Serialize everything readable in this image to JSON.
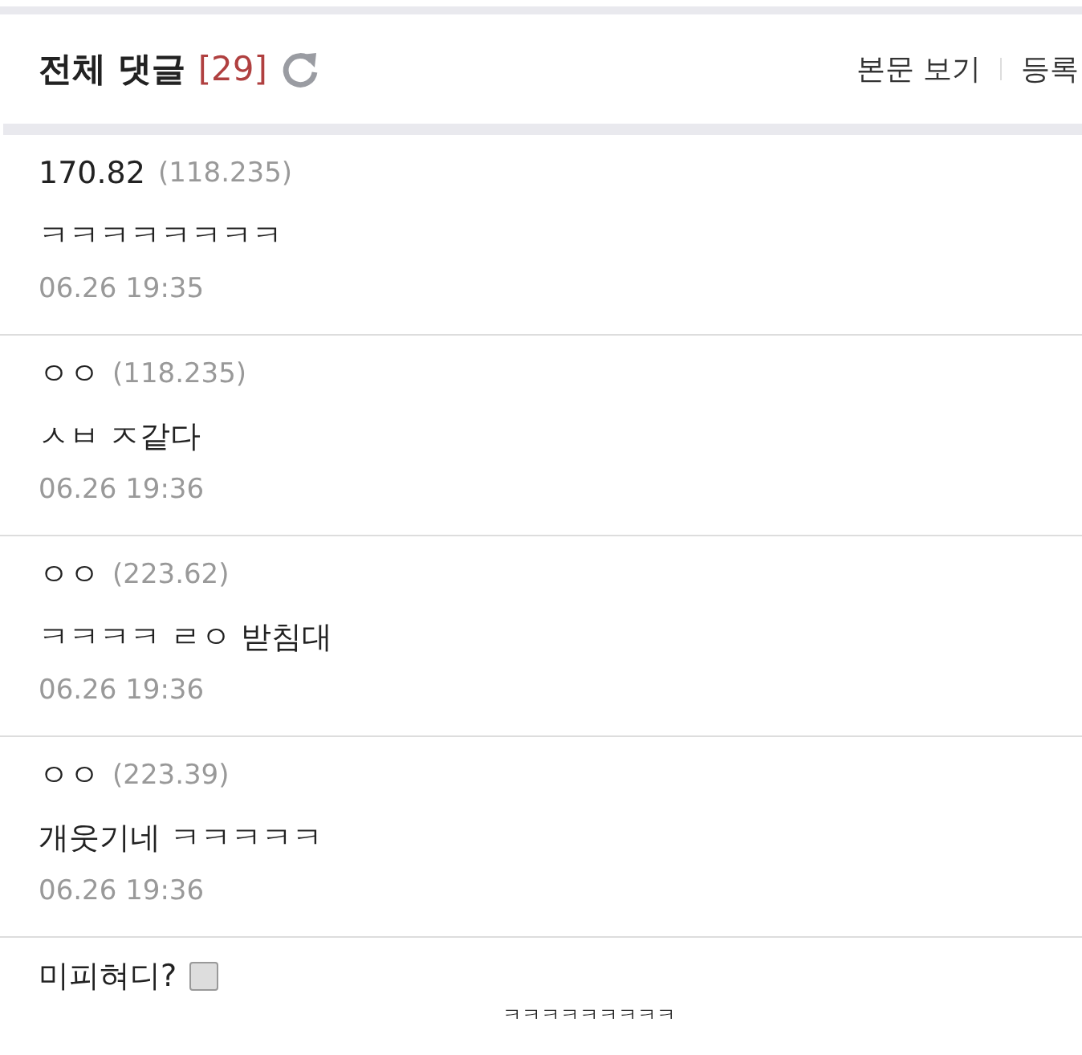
{
  "header": {
    "title": "전체 댓글",
    "count": "[29]",
    "links": [
      "본문 보기",
      "등록"
    ]
  },
  "comments": [
    {
      "name": "170.82",
      "ip": "(118.235)",
      "text": "ㅋㅋㅋㅋㅋㅋㅋㅋ",
      "date": "06.26 19:35"
    },
    {
      "name": "ㅇㅇ",
      "ip": "(118.235)",
      "text": "ㅅㅂ ㅈ같다",
      "date": "06.26 19:36"
    },
    {
      "name": "ㅇㅇ",
      "ip": "(223.62)",
      "text": "ㅋㅋㅋㅋ ㄹㅇ 받침대",
      "date": "06.26 19:36"
    },
    {
      "name": "ㅇㅇ",
      "ip": "(223.39)",
      "text": "개웃기네 ㅋㅋㅋㅋㅋ",
      "date": "06.26 19:36"
    },
    {
      "name": "미피혀디?",
      "kind": "partial"
    }
  ],
  "caption": "ㅋㅋㅋㅋㅋㅋㅋㅋㅋ"
}
